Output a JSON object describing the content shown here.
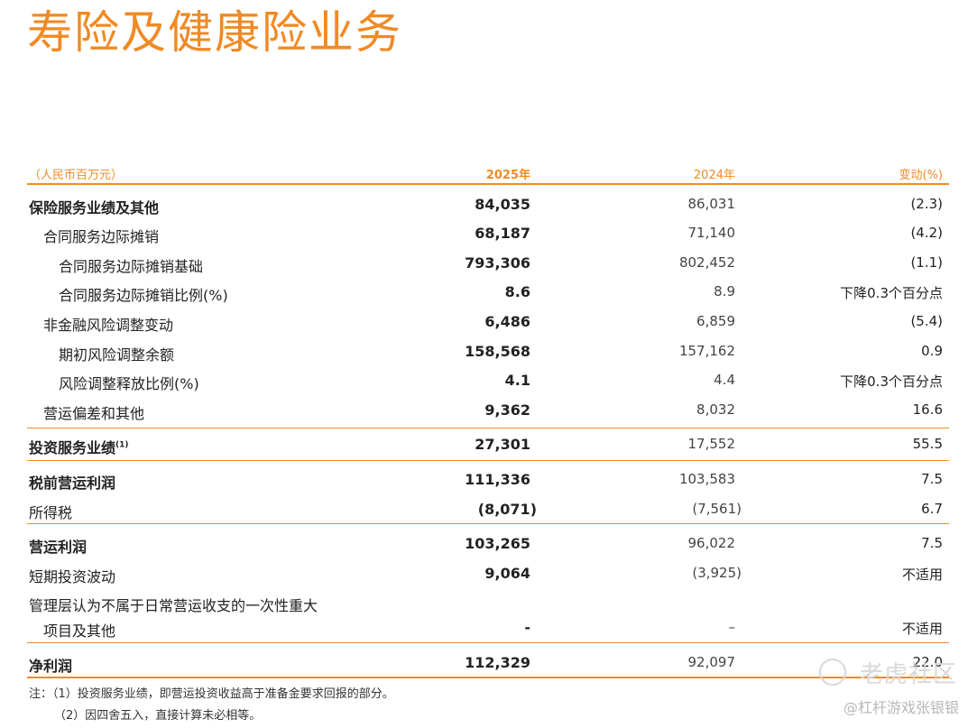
{
  "title": "寿险及健康险业务",
  "table": {
    "headers": {
      "label": "（人民币百万元）",
      "y2025": "2025年",
      "y2024": "2024年",
      "change": "变动(%)"
    },
    "rows": [
      {
        "label": "保险服务业绩及其他",
        "v2025": "84,035",
        "v2024": "86,031",
        "change": "(2.3)"
      },
      {
        "label": "合同服务边际摊销",
        "v2025": "68,187",
        "v2024": "71,140",
        "change": "(4.2)"
      },
      {
        "label": "合同服务边际摊销基础",
        "v2025": "793,306",
        "v2024": "802,452",
        "change": "(1.1)"
      },
      {
        "label": "合同服务边际摊销比例(%)",
        "v2025": "8.6",
        "v2024": "8.9",
        "change": "下降0.3个百分点"
      },
      {
        "label": "非金融风险调整变动",
        "v2025": "6,486",
        "v2024": "6,859",
        "change": "(5.4)"
      },
      {
        "label": "期初风险调整余额",
        "v2025": "158,568",
        "v2024": "157,162",
        "change": "0.9"
      },
      {
        "label": "风险调整释放比例(%)",
        "v2025": "4.1",
        "v2024": "4.4",
        "change": "下降0.3个百分点"
      },
      {
        "label": "营运偏差和其他",
        "v2025": "9,362",
        "v2024": "8,032",
        "change": "16.6"
      },
      {
        "label": "投资服务业绩",
        "sup": "(1)",
        "v2025": "27,301",
        "v2024": "17,552",
        "change": "55.5"
      },
      {
        "label": "税前营运利润",
        "v2025": "111,336",
        "v2024": "103,583",
        "change": "7.5"
      },
      {
        "label": "所得税",
        "v2025": "(8,071)",
        "v2024": "(7,561)",
        "change": "6.7"
      },
      {
        "label": "营运利润",
        "v2025": "103,265",
        "v2024": "96,022",
        "change": "7.5"
      },
      {
        "label": "短期投资波动",
        "v2025": "9,064",
        "v2024": "(3,925)",
        "change": "不适用"
      },
      {
        "label": "管理层认为不属于日常营运收支的一次性重大",
        "label2": "项目及其他",
        "v2025": "-",
        "v2024": "–",
        "change": "不适用"
      },
      {
        "label": "净利润",
        "v2025": "112,329",
        "v2024": "92,097",
        "change": "22.0"
      }
    ]
  },
  "notes": [
    "注：（1）投资服务业绩，即营运投资收益高于准备金要求回报的部分。",
    "（2）因四舍五入，直接计算未必相等。"
  ],
  "watermark": {
    "brand": "老虎社区",
    "author": "@杠杆游戏张银银"
  },
  "colors": {
    "accent": "#f08a24"
  }
}
